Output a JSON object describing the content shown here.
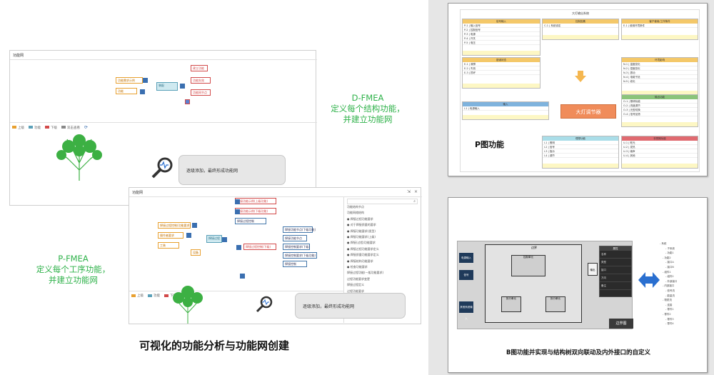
{
  "left": {
    "shot1": {
      "title": "功能网",
      "center": "装配",
      "left_nodes": [
        "功能需求示例",
        "功能",
        "功能"
      ],
      "right_nodes": [
        "建立功能",
        "功能失效",
        "功能网节点"
      ],
      "legend": [
        "上级",
        "功能",
        "下级",
        "双击查看"
      ]
    },
    "dfmea": {
      "title": "D-FMEA",
      "line1": "定义每个结构功能，",
      "line2": "并建立功能网"
    },
    "bubble1": "逐级添加，最终形成功能网",
    "shot2": {
      "title": "功能网",
      "center": "焊接过程",
      "left_nodes": [
        "焊接过程控制(功能要求)",
        "操作者要求",
        "工装",
        "设备"
      ],
      "mid_nodes": [
        "焊接功能示例(上级功能)",
        "焊接功能示例(下级功能)",
        "焊接过程控制",
        "焊接过程控制(下级)"
      ],
      "right_nodes": [
        "焊接功能节点(下级功能)",
        "焊接功能节点",
        "焊接控制要求(下级)",
        "焊接控制要求(下级功能)",
        "焊接控制"
      ],
      "legend": [
        "上级",
        "功能",
        "下级"
      ],
      "list": [
        "功能结构节点",
        "功能网络结构",
        "焊接过程功能要求",
        "对于焊接质量的要求",
        "焊接功能要求(类型)",
        "焊接功能要求(上级)",
        "焊接(过程)功能要求",
        "焊接过程功能要求定义",
        "焊接质量功能要求定义",
        "焊接结构功能要求",
        "检查功能要求",
        "焊接过程功能(一般功能要求)",
        "过程功能要求变更",
        "焊接过程定义",
        "过程功能要求",
        "焊接功能定义",
        "功能说明",
        "过程定义",
        "功能"
      ]
    },
    "pfmea": {
      "title": "P-FMEA",
      "line1": "定义每个工序功能，",
      "line2": "并建立功能网"
    },
    "bubble2": "逐级添加，最终形成功能网",
    "caption": "可视化的功能分析与功能网创建"
  },
  "right_top": {
    "title": "大灯输出系统",
    "boxes": {
      "signal": {
        "head": "信号输入",
        "rows": [
          "P-1 | 输入信号",
          "P-2 | 控制信号",
          "P-3 | 电源",
          "P-4 | 开关",
          "P-5 | 电压"
        ]
      },
      "control": {
        "head": "控制因素",
        "rows": [
          "C-1 | 系统设定"
        ]
      },
      "noise": {
        "head": "客户使用/工作条件",
        "rows": [
          "E-1 | 使用环境条件"
        ]
      },
      "error": {
        "head": "错误状态",
        "rows": [
          "E-1 | 故障",
          "E-2 | 失效",
          "E-3 | 损坏"
        ]
      },
      "env": {
        "head": "环境影响",
        "rows": [
          "N-1 | 温度变化",
          "N-2 | 湿度变化",
          "N-3 | 振动",
          "N-4 | 电磁干扰",
          "N-5 | 老化"
        ]
      },
      "input": {
        "head": "输入",
        "rows": [
          "I-1 | 电源输入"
        ]
      },
      "output": {
        "head": "输出功能",
        "rows": [
          "O-1 | 照明功能",
          "O-2 | 亮度调节",
          "O-3 | 光型切换",
          "O-4 | 信号反馈"
        ]
      },
      "ideal": {
        "head": "理想功能",
        "rows": [
          "I-1 | 照明",
          "I-2 | 信号",
          "I-3 | 指示",
          "I-4 | 调节"
        ]
      },
      "unintended": {
        "head": "非预期功能",
        "rows": [
          "U-1 | 眩光",
          "U-2 | 发热",
          "U-3 | 噪声",
          "U-4 | 其他"
        ]
      }
    },
    "center": "大灯调节器",
    "caption": "P图功能"
  },
  "right_bot": {
    "header": "边界",
    "left_blocks": [
      "电源输入",
      "信号",
      "其他系统输入"
    ],
    "inner_top": "控制单元",
    "inner_bot": "执行单元",
    "right_small": "输出",
    "panel_title": "属性",
    "panel_rows": [
      "名称",
      "类型",
      "接口",
      "方向",
      "备注"
    ],
    "badge": "边界图",
    "tree": [
      "系统",
      "子系统",
      "功能1",
      "功能2",
      "接口A",
      "接口B",
      "组件1",
      "组件2",
      "外部接口",
      "内部接口",
      "信号流",
      "能量流",
      "物质流",
      "连接",
      "零件1",
      "零件2",
      "零件3",
      "零件4"
    ],
    "caption": "B图功能并实现与结构树双向联动及内外接口的自定义"
  },
  "colors": {
    "green": "#2fb24a",
    "orange": "#f08c5a",
    "blue_arrow": "#2a6fd0"
  }
}
